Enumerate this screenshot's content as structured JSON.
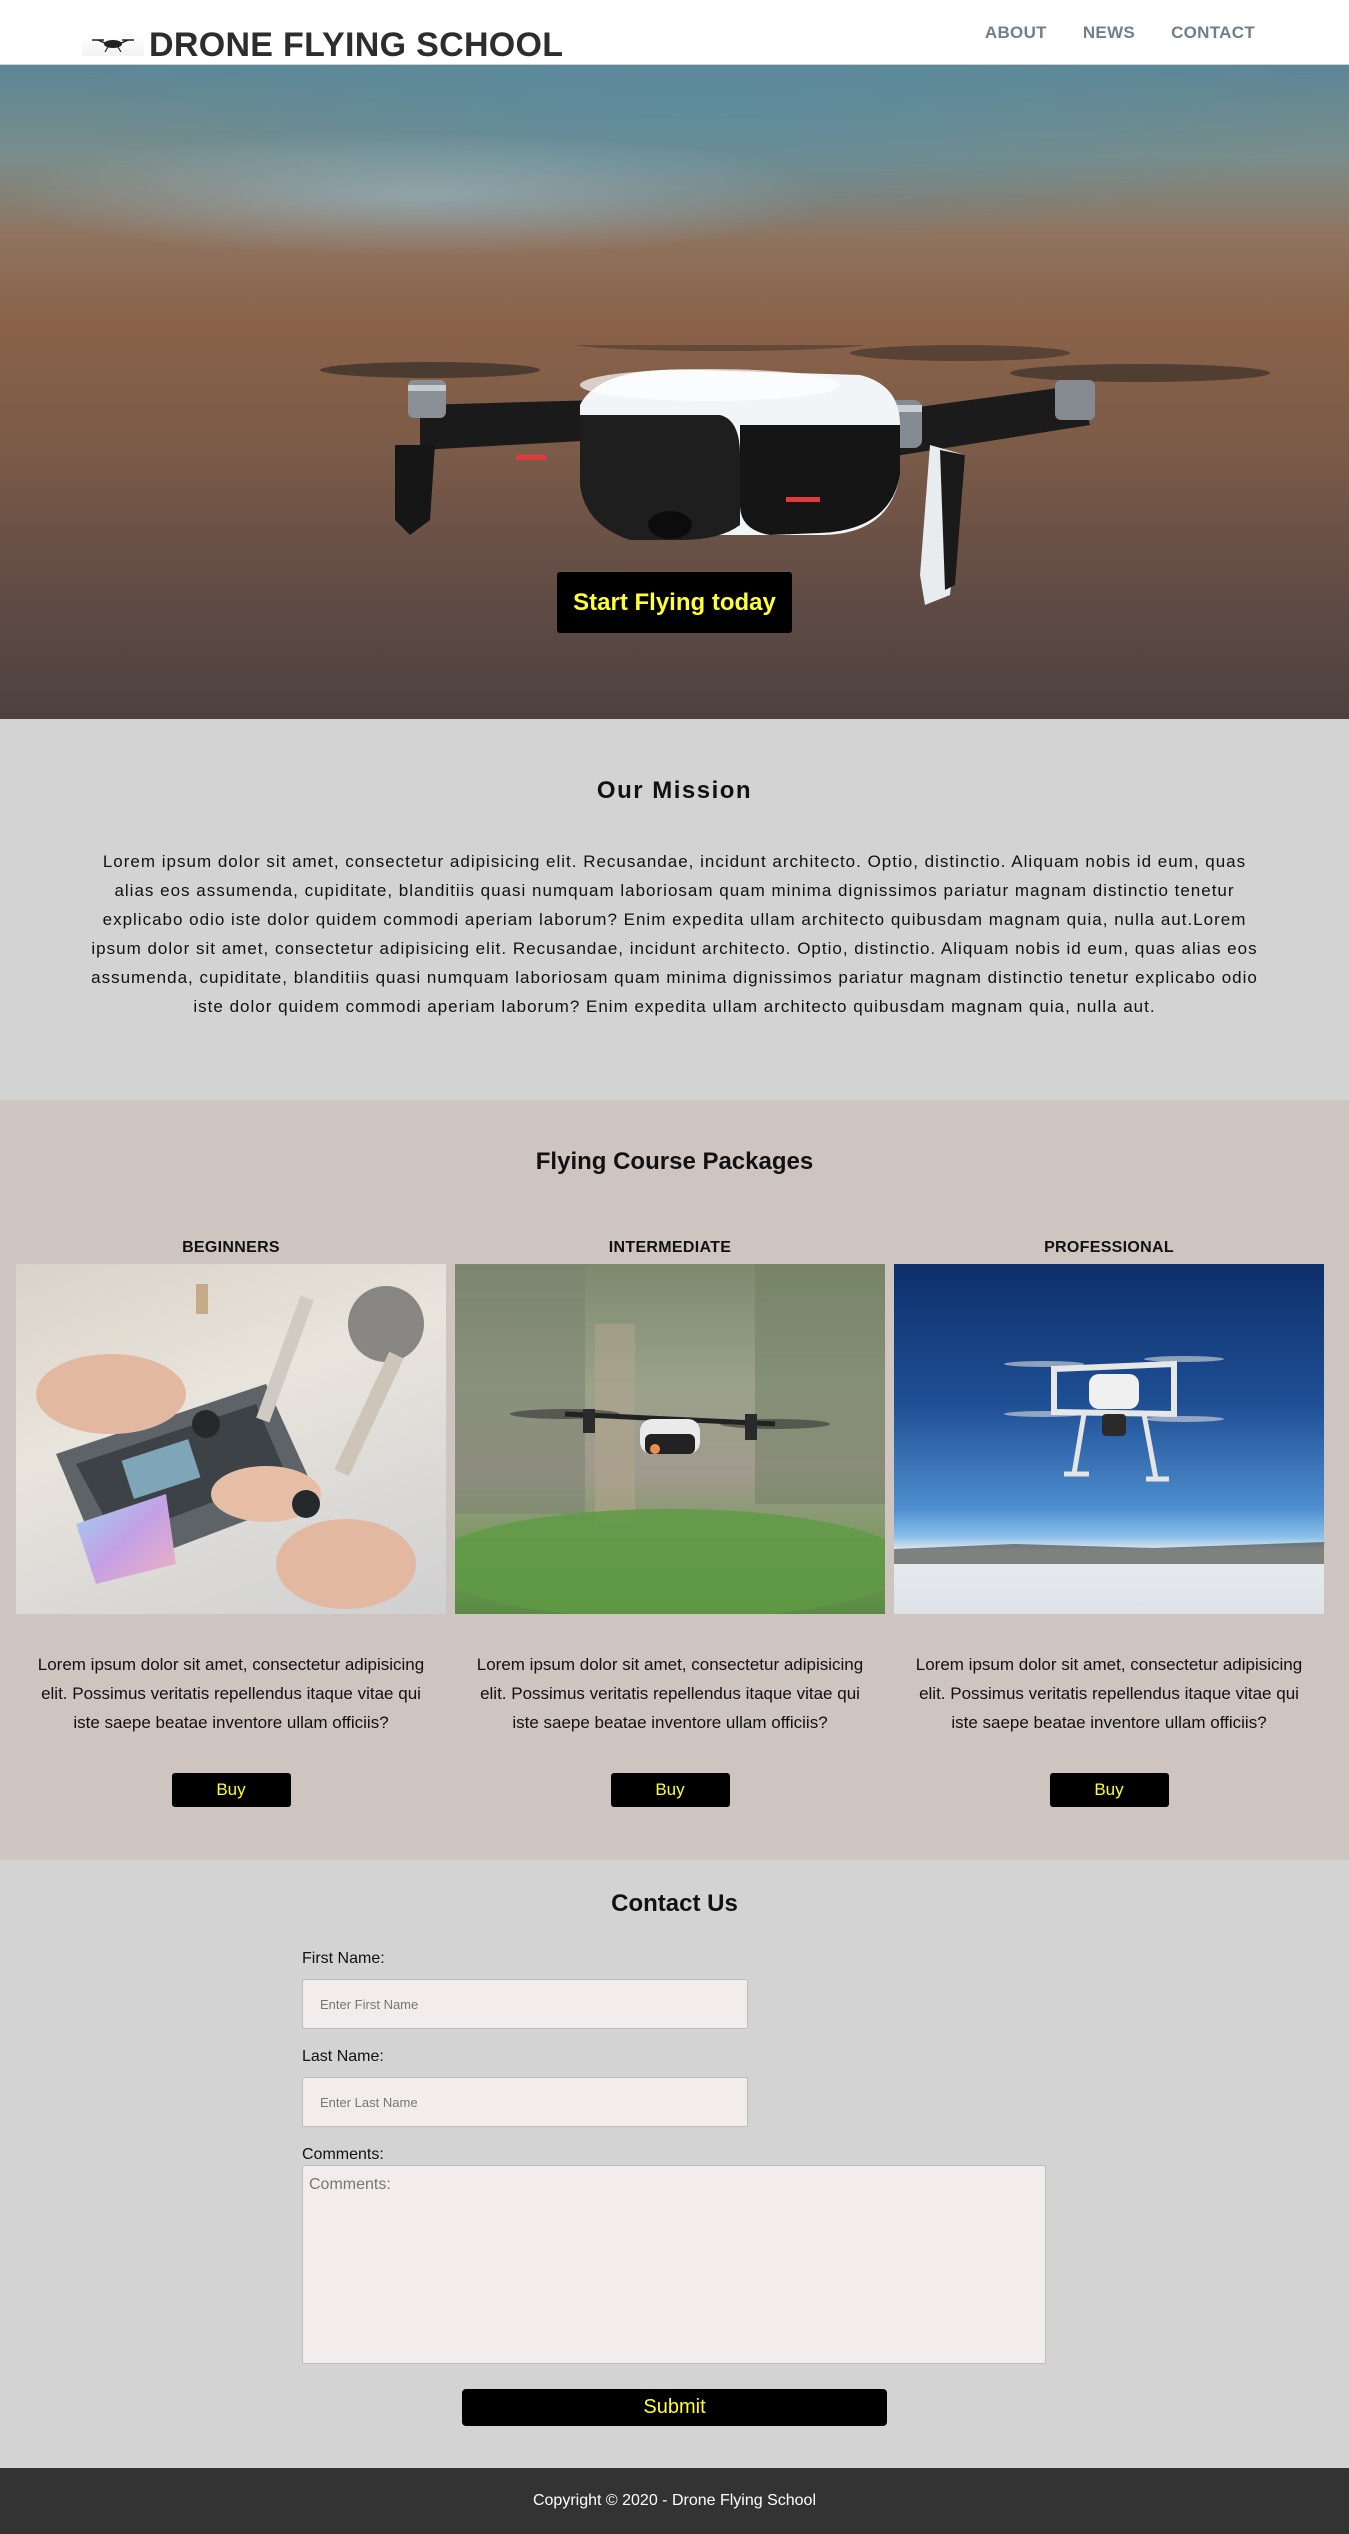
{
  "header": {
    "brand": "DRONE FLYING SCHOOL",
    "logo_icon": "drone-icon",
    "nav": [
      {
        "label": "ABOUT"
      },
      {
        "label": "NEWS"
      },
      {
        "label": "CONTACT"
      }
    ]
  },
  "hero": {
    "cta_label": "Start Flying today",
    "image": "drone-hovering-photo"
  },
  "mission": {
    "title": "Our Mission",
    "body": "Lorem ipsum dolor sit amet, consectetur adipisicing elit. Recusandae, incidunt architecto. Optio, distinctio. Aliquam nobis id eum, quas alias eos assumenda, cupiditate, blanditiis quasi numquam laboriosam quam minima dignissimos pariatur magnam distinctio tenetur explicabo odio iste dolor quidem commodi aperiam laborum? Enim expedita ullam architecto quibusdam magnam quia, nulla aut.Lorem ipsum dolor sit amet, consectetur adipisicing elit. Recusandae, incidunt architecto. Optio, distinctio. Aliquam nobis id eum, quas alias eos assumenda, cupiditate, blanditiis quasi numquam laboriosam quam minima dignissimos pariatur magnam distinctio tenetur explicabo odio iste dolor quidem commodi aperiam laborum? Enim expedita ullam architecto quibusdam magnam quia, nulla aut."
  },
  "packages": {
    "title": "Flying Course Packages",
    "items": [
      {
        "name": "BEGINNERS",
        "image": "drone-remote-controller-photo",
        "description": "Lorem ipsum dolor sit amet, consectetur adipisicing elit. Possimus veritatis repellendus itaque vitae qui iste saepe beatae inventore ullam officiis?",
        "button": "Buy"
      },
      {
        "name": "INTERMEDIATE",
        "image": "small-drone-flying-photo",
        "description": "Lorem ipsum dolor sit amet, consectetur adipisicing elit. Possimus veritatis repellendus itaque vitae qui iste saepe beatae inventore ullam officiis?",
        "button": "Buy"
      },
      {
        "name": "PROFESSIONAL",
        "image": "quadcopter-blue-sky-photo",
        "description": "Lorem ipsum dolor sit amet, consectetur adipisicing elit. Possimus veritatis repellendus itaque vitae qui iste saepe beatae inventore ullam officiis?",
        "button": "Buy"
      }
    ]
  },
  "contact": {
    "title": "Contact Us",
    "first_name_label": "First Name:",
    "first_name_placeholder": "Enter First Name",
    "last_name_label": "Last Name:",
    "last_name_placeholder": "Enter Last Name",
    "comments_label": "Comments:",
    "comments_placeholder": "Comments:",
    "submit_label": "Submit"
  },
  "footer": {
    "copyright": "Copyright © 2020 - Drone Flying School"
  },
  "colors": {
    "accent_text": "#ffff33",
    "button_bg": "#000000",
    "nav_text": "#6e7f8e",
    "packages_bg": "#cec4c0",
    "section_bg": "#d3d3d3",
    "footer_bg": "#333333"
  }
}
